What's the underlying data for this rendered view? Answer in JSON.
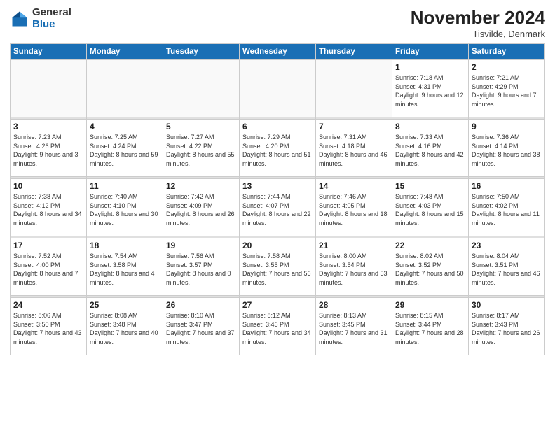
{
  "logo": {
    "general": "General",
    "blue": "Blue"
  },
  "title": "November 2024",
  "location": "Tisvilde, Denmark",
  "days_header": [
    "Sunday",
    "Monday",
    "Tuesday",
    "Wednesday",
    "Thursday",
    "Friday",
    "Saturday"
  ],
  "weeks": [
    [
      {
        "day": "",
        "info": ""
      },
      {
        "day": "",
        "info": ""
      },
      {
        "day": "",
        "info": ""
      },
      {
        "day": "",
        "info": ""
      },
      {
        "day": "",
        "info": ""
      },
      {
        "day": "1",
        "info": "Sunrise: 7:18 AM\nSunset: 4:31 PM\nDaylight: 9 hours\nand 12 minutes."
      },
      {
        "day": "2",
        "info": "Sunrise: 7:21 AM\nSunset: 4:29 PM\nDaylight: 9 hours\nand 7 minutes."
      }
    ],
    [
      {
        "day": "3",
        "info": "Sunrise: 7:23 AM\nSunset: 4:26 PM\nDaylight: 9 hours\nand 3 minutes."
      },
      {
        "day": "4",
        "info": "Sunrise: 7:25 AM\nSunset: 4:24 PM\nDaylight: 8 hours\nand 59 minutes."
      },
      {
        "day": "5",
        "info": "Sunrise: 7:27 AM\nSunset: 4:22 PM\nDaylight: 8 hours\nand 55 minutes."
      },
      {
        "day": "6",
        "info": "Sunrise: 7:29 AM\nSunset: 4:20 PM\nDaylight: 8 hours\nand 51 minutes."
      },
      {
        "day": "7",
        "info": "Sunrise: 7:31 AM\nSunset: 4:18 PM\nDaylight: 8 hours\nand 46 minutes."
      },
      {
        "day": "8",
        "info": "Sunrise: 7:33 AM\nSunset: 4:16 PM\nDaylight: 8 hours\nand 42 minutes."
      },
      {
        "day": "9",
        "info": "Sunrise: 7:36 AM\nSunset: 4:14 PM\nDaylight: 8 hours\nand 38 minutes."
      }
    ],
    [
      {
        "day": "10",
        "info": "Sunrise: 7:38 AM\nSunset: 4:12 PM\nDaylight: 8 hours\nand 34 minutes."
      },
      {
        "day": "11",
        "info": "Sunrise: 7:40 AM\nSunset: 4:10 PM\nDaylight: 8 hours\nand 30 minutes."
      },
      {
        "day": "12",
        "info": "Sunrise: 7:42 AM\nSunset: 4:09 PM\nDaylight: 8 hours\nand 26 minutes."
      },
      {
        "day": "13",
        "info": "Sunrise: 7:44 AM\nSunset: 4:07 PM\nDaylight: 8 hours\nand 22 minutes."
      },
      {
        "day": "14",
        "info": "Sunrise: 7:46 AM\nSunset: 4:05 PM\nDaylight: 8 hours\nand 18 minutes."
      },
      {
        "day": "15",
        "info": "Sunrise: 7:48 AM\nSunset: 4:03 PM\nDaylight: 8 hours\nand 15 minutes."
      },
      {
        "day": "16",
        "info": "Sunrise: 7:50 AM\nSunset: 4:02 PM\nDaylight: 8 hours\nand 11 minutes."
      }
    ],
    [
      {
        "day": "17",
        "info": "Sunrise: 7:52 AM\nSunset: 4:00 PM\nDaylight: 8 hours\nand 7 minutes."
      },
      {
        "day": "18",
        "info": "Sunrise: 7:54 AM\nSunset: 3:58 PM\nDaylight: 8 hours\nand 4 minutes."
      },
      {
        "day": "19",
        "info": "Sunrise: 7:56 AM\nSunset: 3:57 PM\nDaylight: 8 hours\nand 0 minutes."
      },
      {
        "day": "20",
        "info": "Sunrise: 7:58 AM\nSunset: 3:55 PM\nDaylight: 7 hours\nand 56 minutes."
      },
      {
        "day": "21",
        "info": "Sunrise: 8:00 AM\nSunset: 3:54 PM\nDaylight: 7 hours\nand 53 minutes."
      },
      {
        "day": "22",
        "info": "Sunrise: 8:02 AM\nSunset: 3:52 PM\nDaylight: 7 hours\nand 50 minutes."
      },
      {
        "day": "23",
        "info": "Sunrise: 8:04 AM\nSunset: 3:51 PM\nDaylight: 7 hours\nand 46 minutes."
      }
    ],
    [
      {
        "day": "24",
        "info": "Sunrise: 8:06 AM\nSunset: 3:50 PM\nDaylight: 7 hours\nand 43 minutes."
      },
      {
        "day": "25",
        "info": "Sunrise: 8:08 AM\nSunset: 3:48 PM\nDaylight: 7 hours\nand 40 minutes."
      },
      {
        "day": "26",
        "info": "Sunrise: 8:10 AM\nSunset: 3:47 PM\nDaylight: 7 hours\nand 37 minutes."
      },
      {
        "day": "27",
        "info": "Sunrise: 8:12 AM\nSunset: 3:46 PM\nDaylight: 7 hours\nand 34 minutes."
      },
      {
        "day": "28",
        "info": "Sunrise: 8:13 AM\nSunset: 3:45 PM\nDaylight: 7 hours\nand 31 minutes."
      },
      {
        "day": "29",
        "info": "Sunrise: 8:15 AM\nSunset: 3:44 PM\nDaylight: 7 hours\nand 28 minutes."
      },
      {
        "day": "30",
        "info": "Sunrise: 8:17 AM\nSunset: 3:43 PM\nDaylight: 7 hours\nand 26 minutes."
      }
    ]
  ]
}
